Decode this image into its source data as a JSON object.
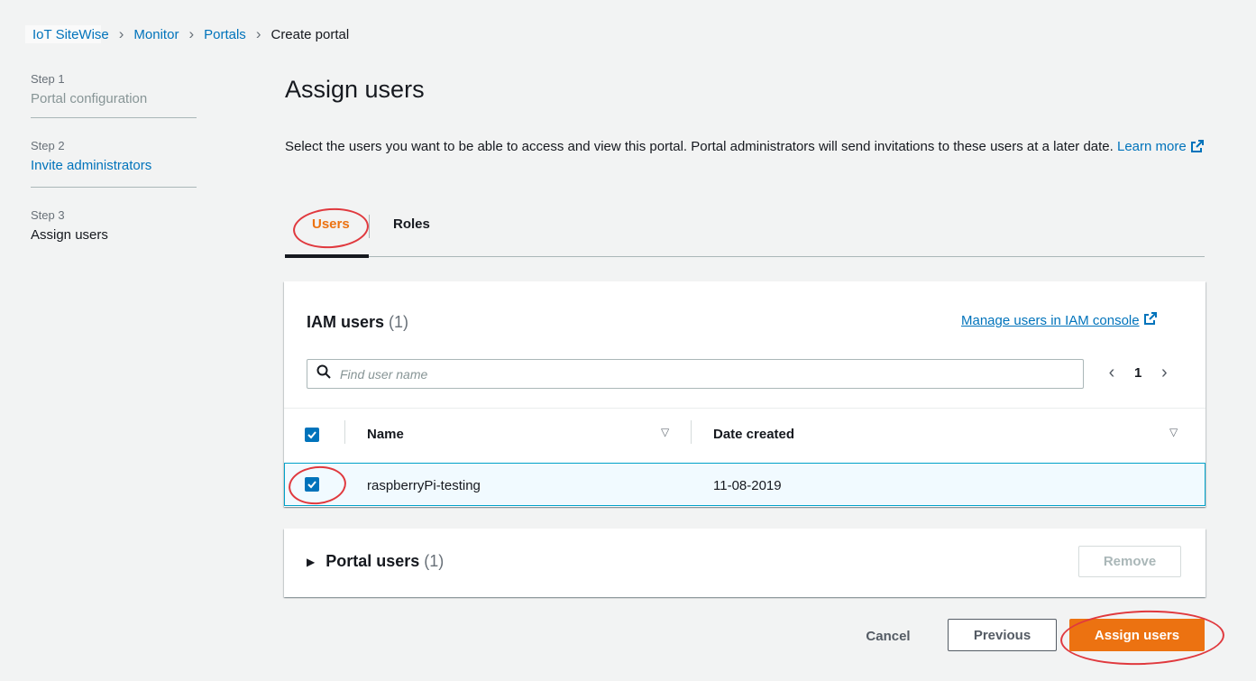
{
  "breadcrumb": {
    "items": [
      "IoT SiteWise",
      "Monitor",
      "Portals"
    ],
    "current": "Create portal",
    "separator": "›"
  },
  "steps": [
    {
      "num": "Step 1",
      "name": "Portal configuration"
    },
    {
      "num": "Step 2",
      "name": "Invite administrators"
    },
    {
      "num": "Step 3",
      "name": "Assign users"
    }
  ],
  "main": {
    "title": "Assign users",
    "description": "Select the users you want to be able to access and view this portal. Portal administrators will send invitations to these users at a later date.",
    "learn_more": "Learn more"
  },
  "tabs": [
    {
      "label": "Users",
      "active": true
    },
    {
      "label": "Roles",
      "active": false
    }
  ],
  "iam_panel": {
    "title": "IAM users",
    "count": "(1)",
    "manage_link": "Manage users in IAM console",
    "search_placeholder": "Find user name",
    "page": "1",
    "columns": [
      "Name",
      "Date created"
    ],
    "rows": [
      {
        "name": "raspberryPi-testing",
        "date": "11-08-2019",
        "selected": true
      }
    ]
  },
  "portal_users": {
    "title": "Portal users",
    "count": "(1)",
    "remove_label": "Remove"
  },
  "footer": {
    "cancel_label": "Cancel",
    "previous_label": "Previous",
    "assign_label": "Assign users"
  },
  "colors": {
    "accent": "#ec7211",
    "link": "#0073bb",
    "annotation": "#e0393e"
  },
  "icons": {
    "external": "external-link-icon",
    "search": "search-icon",
    "sort": "sort-down-icon",
    "check": "check-icon",
    "expand": "caret-right-icon"
  }
}
